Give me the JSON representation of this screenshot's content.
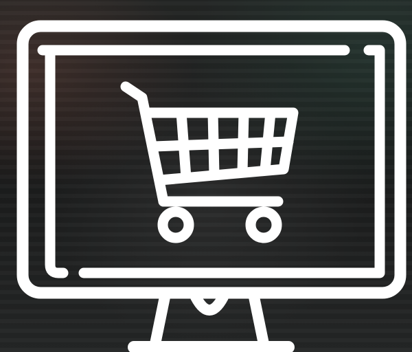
{
  "icon": {
    "name": "monitor-shopping-cart-icon",
    "stroke_color": "#ffffff"
  },
  "background": {
    "base_color": "#1b1c1c"
  }
}
